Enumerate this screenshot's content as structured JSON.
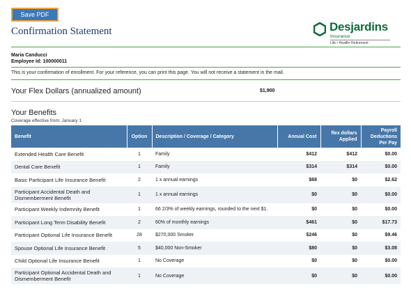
{
  "toolbar": {
    "save_pdf_label": "Save PDF"
  },
  "header": {
    "title": "Confirmation Statement",
    "brand": {
      "name": "Desjardins",
      "sub": "Insurance",
      "tagline": "Life • Health• Retirement",
      "color": "#0f6b3a"
    }
  },
  "employee": {
    "name": "Maria Canducci",
    "id_line": "Employee Id: 100000011"
  },
  "notice": "This is your confirmation of enrollment. For your reference, you can print this page. You will not receive a statement in the mail.",
  "flex": {
    "label": "Your Flex Dollars (annualized amount)",
    "value": "$1,900"
  },
  "benefits": {
    "title": "Your Benefits",
    "coverage_effective": "Coverage effective from: January 1",
    "columns": {
      "benefit": "Benefit",
      "option": "Option",
      "description": "Description / Coverage / Category",
      "annual_cost": "Annual Cost",
      "flex_applied": "flex dollars Applied",
      "payroll": "Payroll Deductions Per Pay"
    },
    "rows": [
      {
        "benefit": "Extended Health Care Benefit",
        "option": "1",
        "description": "Family",
        "annual_cost": "$412",
        "flex_applied": "$412",
        "payroll": "$0.00"
      },
      {
        "benefit": "Dental Care Benefit",
        "option": "1",
        "description": "Family",
        "annual_cost": "$314",
        "flex_applied": "$314",
        "payroll": "$0.00"
      },
      {
        "benefit": "Basic Participant Life Insurance Benefit",
        "option": "2",
        "description": "1 x annual earnings",
        "annual_cost": "$68",
        "flex_applied": "$0",
        "payroll": "$2.62"
      },
      {
        "benefit": "Participant Accidental Death and Dismemberment Benefit",
        "option": "1",
        "description": "1 x annual earnings",
        "annual_cost": "$0",
        "flex_applied": "$0",
        "payroll": "$0.00"
      },
      {
        "benefit": "Participant Weekly Indemnity Benefit",
        "option": "1",
        "description": "66 2/3% of weekly earnings, rounded to the next $1.",
        "annual_cost": "$0",
        "flex_applied": "$0",
        "payroll": "$0.00"
      },
      {
        "benefit": "Participant Long Term Disability Benefit",
        "option": "2",
        "description": "60% of monthly earnings",
        "annual_cost": "$461",
        "flex_applied": "$0",
        "payroll": "$17.73"
      },
      {
        "benefit": "Participant Optional Life Insurance Benefit",
        "option": "28",
        "description": "$270,000 Smoker",
        "annual_cost": "$246",
        "flex_applied": "$0",
        "payroll": "$9.46"
      },
      {
        "benefit": "Spouse Optional Life Insurance Benefit",
        "option": "5",
        "description": "$40,000 Non-Smoker",
        "annual_cost": "$80",
        "flex_applied": "$0",
        "payroll": "$3.08"
      },
      {
        "benefit": "Child Optional Life Insurance Benefit",
        "option": "1",
        "description": "No Coverage",
        "annual_cost": "$0",
        "flex_applied": "$0",
        "payroll": "$0.00"
      },
      {
        "benefit": "Participant Optional Accidental Death and Dismemberment Benefit",
        "option": "1",
        "description": "No Coverage",
        "annual_cost": "$0",
        "flex_applied": "$0",
        "payroll": "$0.00"
      }
    ]
  },
  "colors": {
    "accent": "#3b78b8",
    "button_border": "#f2a43a",
    "table_header": "#4677a8",
    "rule": "#4da24a",
    "title": "#1a3a6b"
  }
}
